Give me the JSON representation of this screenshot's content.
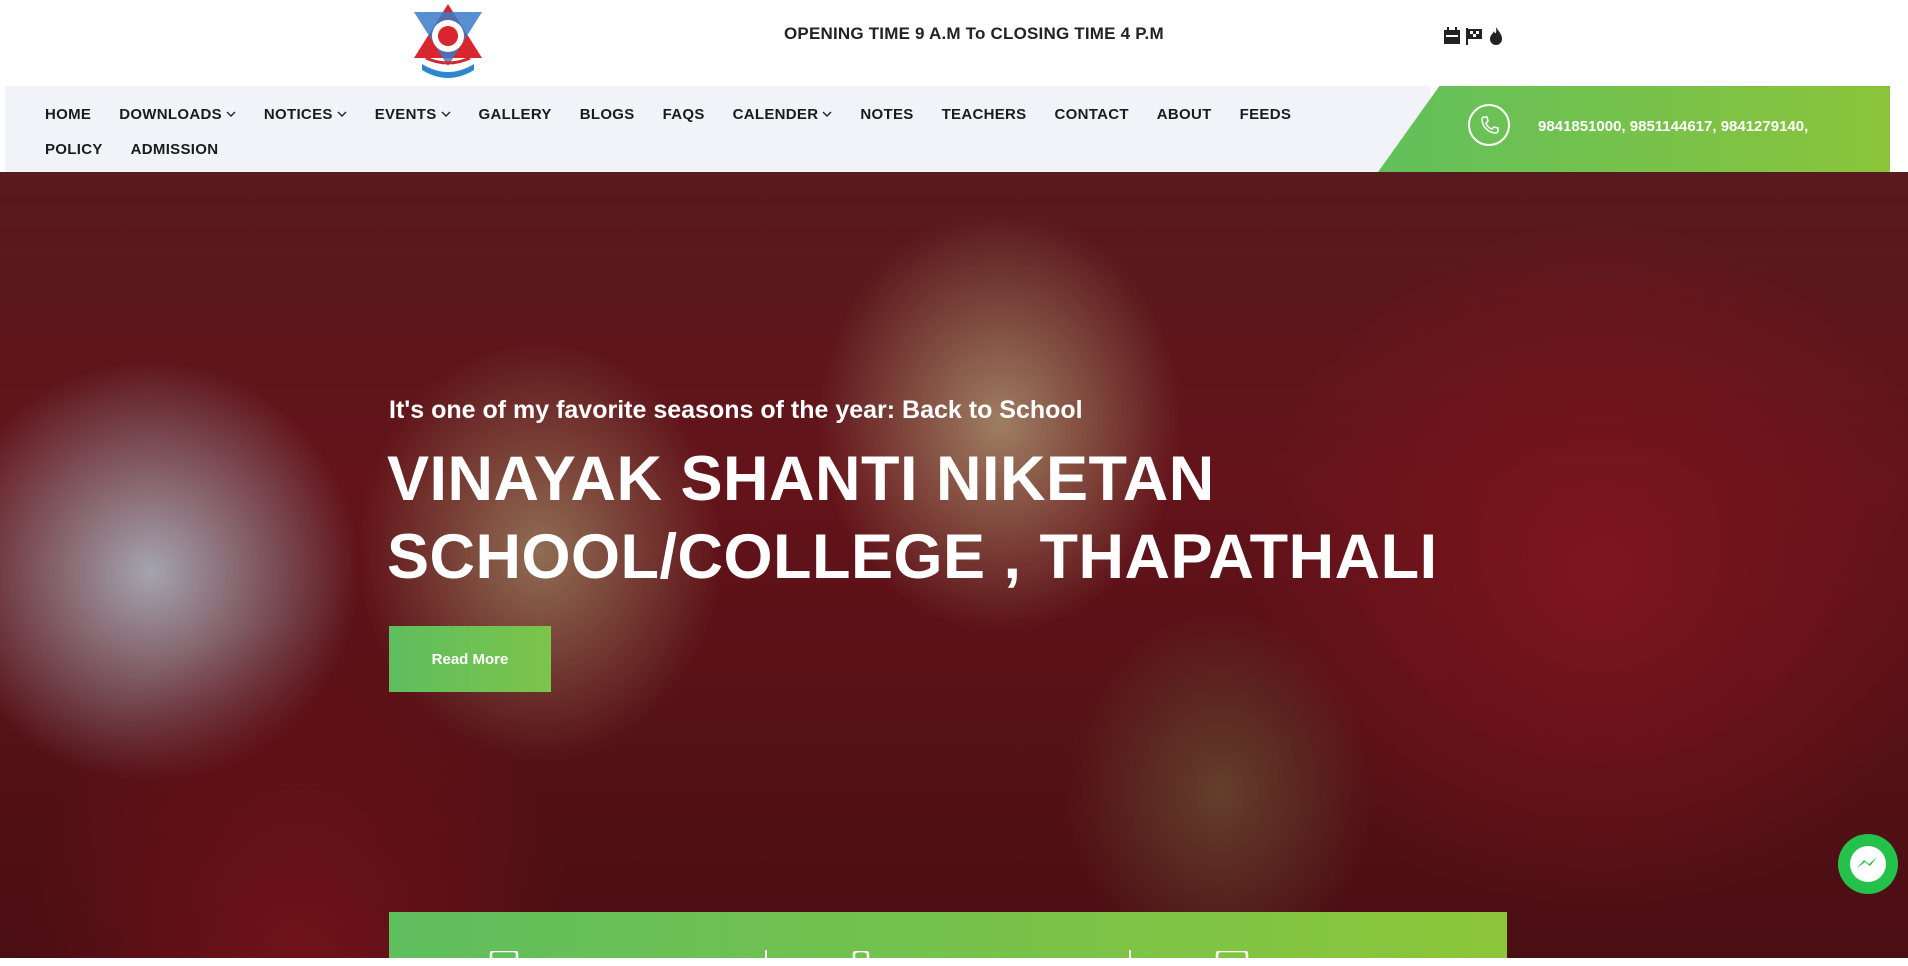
{
  "header": {
    "opening_time": "OPENING TIME 9 A.M To CLOSING TIME 4 P.M",
    "icons": [
      "calendar-icon",
      "flag-icon",
      "fire-icon"
    ]
  },
  "nav": {
    "row1": [
      {
        "label": "HOME",
        "dropdown": false
      },
      {
        "label": "DOWNLOADS",
        "dropdown": true
      },
      {
        "label": "NOTICES",
        "dropdown": true
      },
      {
        "label": "EVENTS",
        "dropdown": true
      },
      {
        "label": "GALLERY",
        "dropdown": false
      },
      {
        "label": "BLOGS",
        "dropdown": false
      },
      {
        "label": "FAQS",
        "dropdown": false
      },
      {
        "label": "CALENDER",
        "dropdown": true
      },
      {
        "label": "NOTES",
        "dropdown": false
      },
      {
        "label": "TEACHERS",
        "dropdown": false
      },
      {
        "label": "CONTACT",
        "dropdown": false
      },
      {
        "label": "ABOUT",
        "dropdown": false
      },
      {
        "label": "FEEDS",
        "dropdown": false
      }
    ],
    "row2": [
      {
        "label": "POLICY",
        "dropdown": false
      },
      {
        "label": "ADMISSION",
        "dropdown": false
      }
    ]
  },
  "contact": {
    "phones": "9841851000, 9851144617, 9841279140,"
  },
  "hero": {
    "subtitle": "It's one of my favorite seasons of the year: Back to School",
    "title_line1": "VINAYAK SHANTI NIKETAN",
    "title_line2": "SCHOOL/COLLEGE , THAPATHALI",
    "read_more": "Read More"
  },
  "colors": {
    "accent_green": "#62c05c",
    "accent_lime": "#8ac43a",
    "nav_bg": "#f2f3f8"
  }
}
